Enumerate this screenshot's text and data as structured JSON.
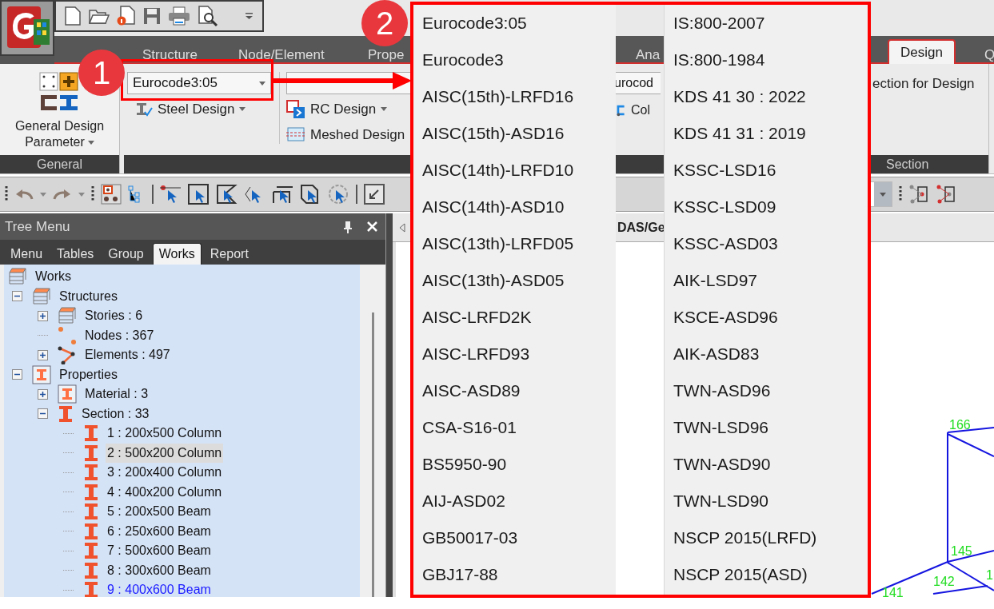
{
  "ribbon_tabs": [
    {
      "label": "Structure",
      "selected": false
    },
    {
      "label": "Node/Element",
      "selected": false
    },
    {
      "label": "Prope",
      "selected": false
    },
    {
      "label": "Ana",
      "selected": false
    },
    {
      "label": "Design",
      "selected": true
    },
    {
      "label": "Q",
      "selected": false
    }
  ],
  "ribbon": {
    "general_button": [
      "General Design",
      "Parameter"
    ],
    "general_group": "General",
    "steel_code_combo": {
      "value": "Eurocode3:05"
    },
    "steel_design": "Steel Design",
    "rc_design": "RC Design",
    "meshed_design": "Meshed Design",
    "cold_code_combo": {
      "value": "urocod"
    },
    "cold_button": "Col",
    "section_button": "ection for Design",
    "section_group": "Section"
  },
  "tree_menu": {
    "title": "Tree Menu",
    "tabs": [
      {
        "label": "Menu",
        "selected": false
      },
      {
        "label": "Tables",
        "selected": false
      },
      {
        "label": "Group",
        "selected": false
      },
      {
        "label": "Works",
        "selected": true
      },
      {
        "label": "Report",
        "selected": false
      }
    ],
    "tree": [
      {
        "label": "Works",
        "kind": "stack",
        "selected": false,
        "children": [
          {
            "label": "Structures",
            "kind": "stack",
            "expanded": true,
            "selected": false,
            "children": [
              {
                "label": "Stories : 6",
                "kind": "stack",
                "expanded": false,
                "selected": false
              },
              {
                "label": "Nodes : 367",
                "kind": "nodes",
                "selected": false
              },
              {
                "label": "Elements : 497",
                "kind": "elements",
                "expanded": false,
                "selected": false
              }
            ]
          },
          {
            "label": "Properties",
            "kind": "framed-beam",
            "expanded": true,
            "selected": false,
            "children": [
              {
                "label": "Material : 3",
                "kind": "framed-beam",
                "expanded": false,
                "selected": false
              },
              {
                "label": "Section : 33",
                "kind": "beam",
                "expanded": true,
                "selected": false,
                "children": [
                  {
                    "label": "1 : 200x500 Column",
                    "kind": "beam",
                    "selected": false,
                    "hovered": false
                  },
                  {
                    "label": "2 : 500x200 Column",
                    "kind": "beam",
                    "selected": true,
                    "hovered": false
                  },
                  {
                    "label": "3 : 200x400 Column",
                    "kind": "beam",
                    "selected": false,
                    "hovered": false
                  },
                  {
                    "label": "4 : 400x200 Column",
                    "kind": "beam",
                    "selected": false,
                    "hovered": false
                  },
                  {
                    "label": "5 : 200x500 Beam",
                    "kind": "beam",
                    "selected": false,
                    "hovered": false
                  },
                  {
                    "label": "6 : 250x600 Beam",
                    "kind": "beam",
                    "selected": false,
                    "hovered": false
                  },
                  {
                    "label": "7 : 500x600 Beam",
                    "kind": "beam",
                    "selected": false,
                    "hovered": false
                  },
                  {
                    "label": "8 : 300x600 Beam",
                    "kind": "beam",
                    "selected": false,
                    "hovered": false
                  },
                  {
                    "label": "9 : 400x600 Beam",
                    "kind": "beam",
                    "selected": false,
                    "hovered": true
                  }
                ]
              }
            ]
          }
        ]
      }
    ]
  },
  "viewport": {
    "tab_title": "DAS/Ge",
    "node_labels": [
      "166",
      "145",
      "142",
      "141",
      "1"
    ]
  },
  "code_dropdown": {
    "columns": [
      [
        "Eurocode3:05",
        "Eurocode3",
        "AISC(15th)-LRFD16",
        "AISC(15th)-ASD16",
        "AISC(14th)-LRFD10",
        "AISC(14th)-ASD10",
        "AISC(13th)-LRFD05",
        "AISC(13th)-ASD05",
        "AISC-LRFD2K",
        "AISC-LRFD93",
        "AISC-ASD89",
        "CSA-S16-01",
        "BS5950-90",
        "AIJ-ASD02",
        "GB50017-03",
        "GBJ17-88"
      ],
      [
        "IS:800-2007",
        "IS:800-1984",
        "KDS 41 30 : 2022",
        "KDS 41 31 : 2019",
        "KSSC-LSD16",
        "KSSC-LSD09",
        "KSSC-ASD03",
        "AIK-LSD97",
        "KSCE-ASD96",
        "AIK-ASD83",
        "TWN-ASD96",
        "TWN-LSD96",
        "TWN-ASD90",
        "TWN-LSD90",
        "NSCP 2015(LRFD)",
        "NSCP 2015(ASD)"
      ]
    ]
  },
  "callouts": [
    "1",
    "2"
  ]
}
